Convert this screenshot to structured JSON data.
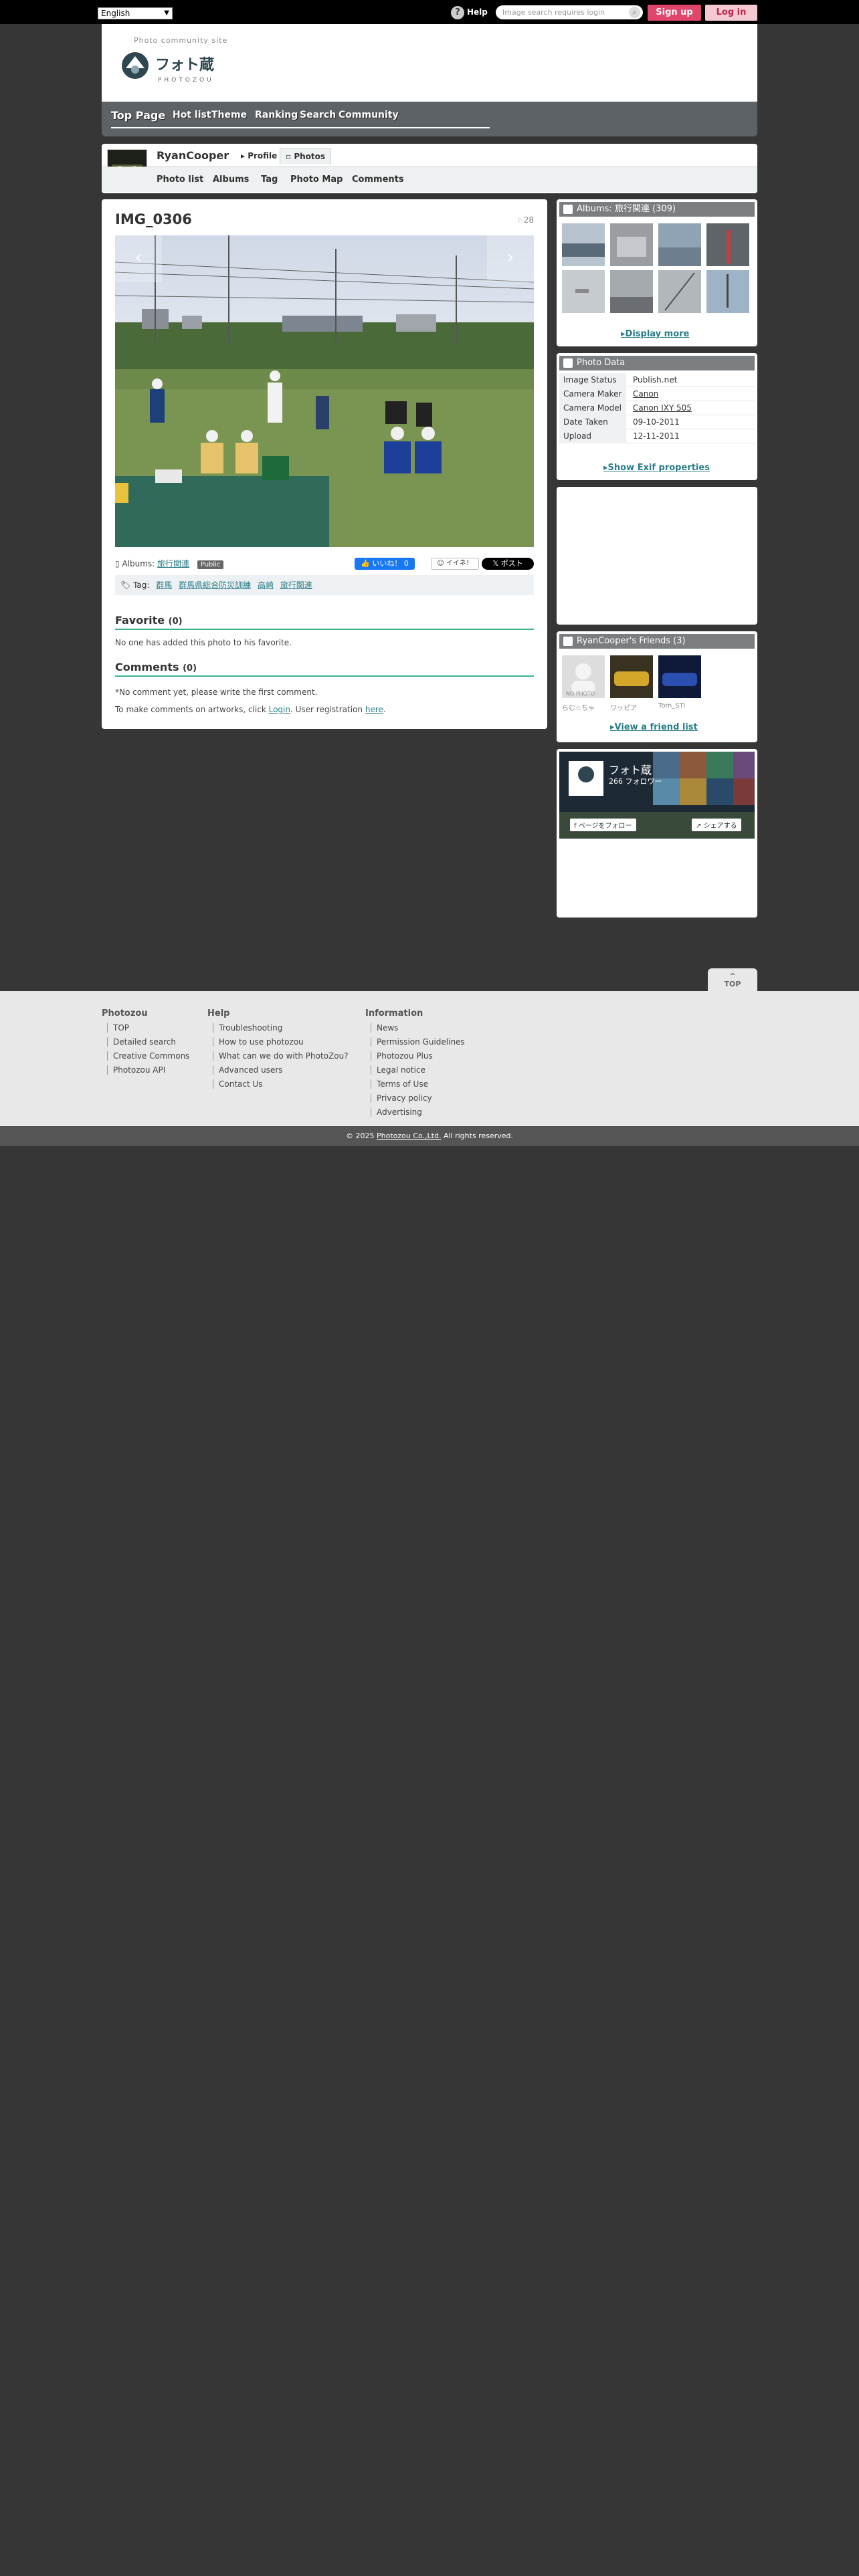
{
  "topbar": {
    "language": "English",
    "help": "Help",
    "search_placeholder": "Image search requires login",
    "signup": "Sign up",
    "login": "Log in"
  },
  "header": {
    "site_sub": "Photo community site",
    "logo_jp": "フォト蔵",
    "logo_en": "PHOTOZOU"
  },
  "nav": {
    "items": [
      "Top Page",
      "Hot list",
      "Theme",
      "Ranking",
      "Search",
      "Community"
    ]
  },
  "user": {
    "name": "RyanCooper",
    "tabs": [
      "Profile",
      "Photos"
    ],
    "subtabs": [
      "Photo list",
      "Albums",
      "Tag",
      "Photo Map",
      "Comments"
    ]
  },
  "photo": {
    "title": "IMG_0306",
    "views": "28",
    "album_label": "Albums:",
    "album_name": "旅行関連",
    "public_badge": "Public",
    "fb_label": "いいね！ 0",
    "iine_label": "イイネ！",
    "x_label": "ポスト",
    "tag_label": "Tag:",
    "tags": [
      "群馬",
      "群馬県総合防災訓練",
      "高崎",
      "旅行関連"
    ]
  },
  "favorite": {
    "title": "Favorite",
    "count": "(0)",
    "text": "No one has added this photo to his favorite."
  },
  "comments": {
    "title": "Comments",
    "count": "(0)",
    "empty": "*No comment yet, please write the first comment.",
    "login_pre": "To make comments on artworks, click",
    "login_link": "Login",
    "login_mid": ". User registration",
    "here": "here",
    "login_end": "."
  },
  "albums_box": {
    "title": "Albums: 旅行関連 (309)",
    "display_more": "Display more"
  },
  "photo_data": {
    "title": "Photo Data",
    "rows": [
      {
        "k": "Image Status",
        "v": "Publish.net"
      },
      {
        "k": "Camera Maker",
        "v": "Canon"
      },
      {
        "k": "Camera Model",
        "v": "Canon IXY 505"
      },
      {
        "k": "Date Taken",
        "v": "09-10-2011"
      },
      {
        "k": "Upload",
        "v": "12-11-2011"
      }
    ],
    "exif": "Show Exif properties"
  },
  "friends": {
    "title": "RyanCooper's Friends (3)",
    "names": [
      "らむ☆ちゃ",
      "ワッピア",
      "Tom_STi"
    ],
    "no_photo": "NO PHOTO",
    "view_list": "View a friend list"
  },
  "fbwidget": {
    "name": "フォト蔵",
    "followers": "266 フォロワー",
    "follow": "ページをフォロー",
    "share": "シェアする"
  },
  "top_button": "TOP",
  "footer": {
    "col1": {
      "title": "Photozou",
      "links": [
        "TOP",
        "Detailed search",
        "Creative Commons",
        "Photozou API"
      ]
    },
    "col2": {
      "title": "Help",
      "links": [
        "Troubleshooting",
        "How to use photozou",
        "What can we do with PhotoZou?",
        "Advanced users",
        "Contact Us"
      ]
    },
    "col3": {
      "title": "Information",
      "links": [
        "News",
        "Permission Guidelines",
        "Photozou Plus",
        "Legal notice",
        "Terms of Use",
        "Privacy policy",
        "Advertising"
      ]
    },
    "copyright_pre": "© 2025",
    "copyright_link": "Photozou Co.,Ltd.",
    "copyright_post": "All rights reserved."
  }
}
